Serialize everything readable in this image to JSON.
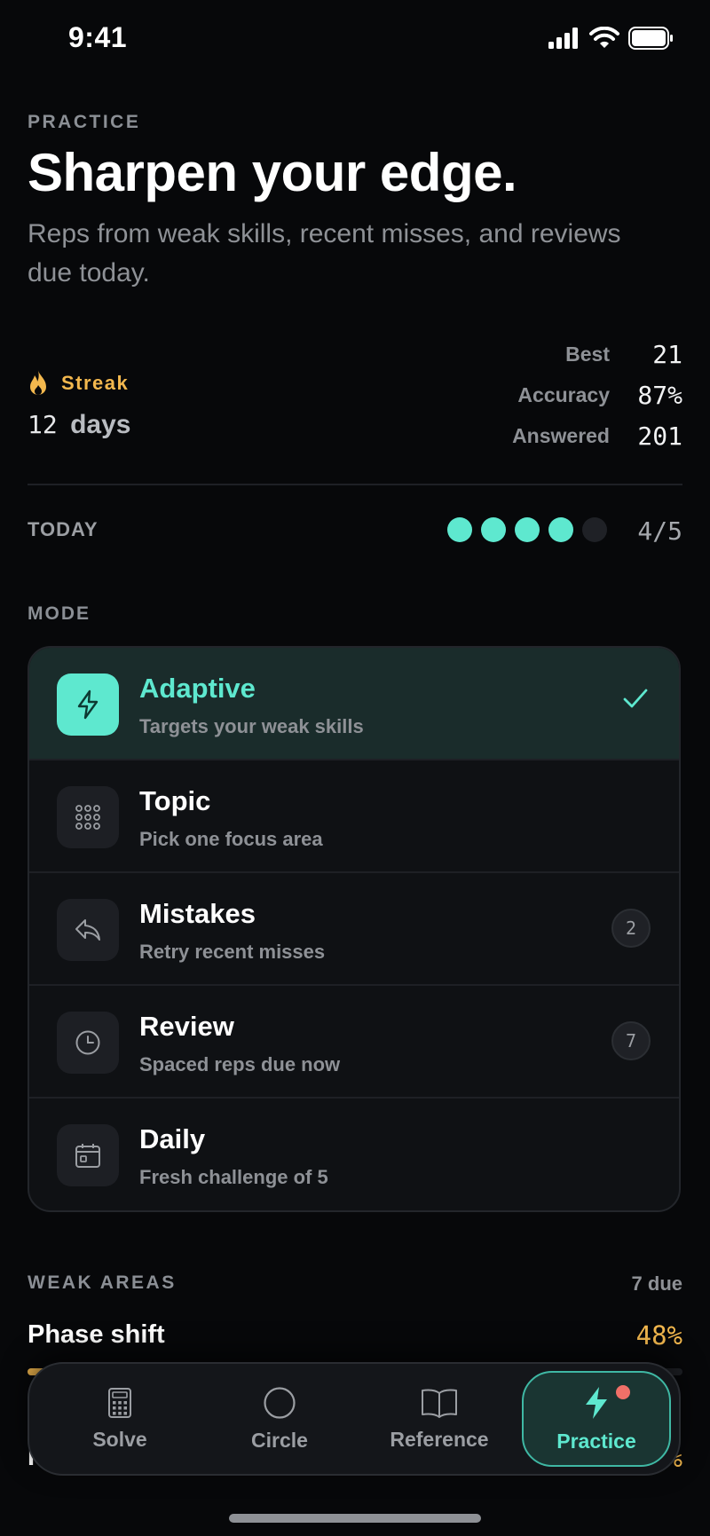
{
  "status": {
    "time": "9:41"
  },
  "header": {
    "eyebrow": "PRACTICE",
    "title": "Sharpen your edge.",
    "subtitle": "Reps from weak skills, recent misses, and reviews due today."
  },
  "streak": {
    "label": "Streak",
    "value": "12",
    "unit": "days",
    "icon": "flame-icon"
  },
  "stats": [
    {
      "label": "Best",
      "value": "21"
    },
    {
      "label": "Accuracy",
      "value": "87%"
    },
    {
      "label": "Answered",
      "value": "201"
    }
  ],
  "today": {
    "label": "TODAY",
    "completed": 4,
    "total": 5,
    "count": "4/5"
  },
  "mode": {
    "label": "MODE",
    "items": [
      {
        "name": "Adaptive",
        "desc": "Targets your weak skills",
        "icon": "bolt-icon",
        "selected": true
      },
      {
        "name": "Topic",
        "desc": "Pick one focus area",
        "icon": "grid-icon"
      },
      {
        "name": "Mistakes",
        "desc": "Retry recent misses",
        "icon": "reply-icon",
        "badge": "2"
      },
      {
        "name": "Review",
        "desc": "Spaced reps due now",
        "icon": "clock-icon",
        "badge": "7"
      },
      {
        "name": "Daily",
        "desc": "Fresh challenge of 5",
        "icon": "calendar-icon"
      }
    ]
  },
  "weak": {
    "label": "WEAK AREAS",
    "due": "7 due",
    "items": [
      {
        "name": "Phase shift",
        "pct": "48%",
        "progress": 0.48
      },
      {
        "name": "R",
        "pct": "%"
      }
    ]
  },
  "tabs": [
    {
      "label": "Solve",
      "icon": "calculator-icon"
    },
    {
      "label": "Circle",
      "icon": "circle-icon"
    },
    {
      "label": "Reference",
      "icon": "book-icon"
    },
    {
      "label": "Practice",
      "icon": "bolt-icon",
      "active": true
    }
  ],
  "colors": {
    "accent": "#5ee8cf",
    "warning": "#f3b84e",
    "background": "#07080a",
    "notification": "#f07068"
  }
}
